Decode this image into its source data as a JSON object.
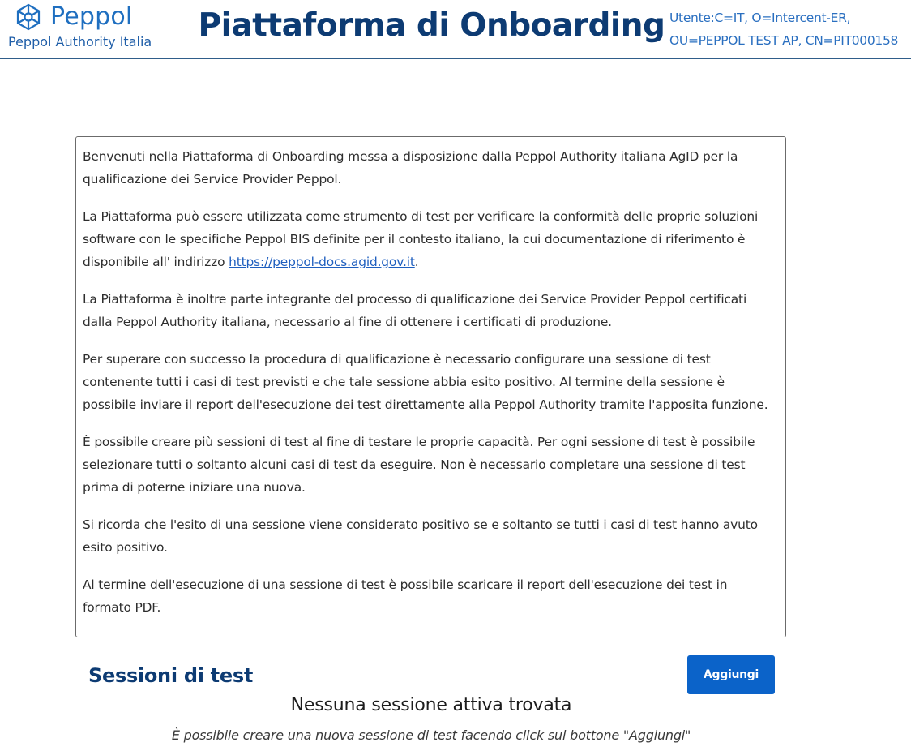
{
  "header": {
    "logo_text": "Peppol",
    "logo_subtitle": "Peppol Authority Italia",
    "title": "Piattaforma di Onboarding",
    "user_line1": "Utente:C=IT, O=Intercent-ER,",
    "user_line2": "OU=PEPPOL TEST AP, CN=PIT000158",
    "logo_icon": "peppol-network-logo",
    "brand_color": "#1f6fc0"
  },
  "intro": {
    "p1": "Benvenuti nella Piattaforma di Onboarding messa a disposizione dalla Peppol Authority italiana AgID per la qualificazione dei Service Provider Peppol.",
    "p2_before": "La Piattaforma può essere utilizzata come strumento di test per verificare la conformità delle proprie soluzioni software con le specifiche Peppol BIS definite per il contesto italiano, la cui documentazione di riferimento è disponibile all' indirizzo ",
    "p2_link": "https://peppol-docs.agid.gov.it",
    "p2_after": ".",
    "p3": "La Piattaforma è inoltre parte integrante del processo di qualificazione dei Service Provider Peppol certificati dalla Peppol Authority italiana, necessario al fine di ottenere i certificati di produzione.",
    "p4": "Per superare con successo la procedura di qualificazione è necessario configurare una sessione di test contenente tutti i casi di test previsti e che tale sessione abbia esito positivo. Al termine della sessione è possibile inviare il report dell'esecuzione dei test direttamente alla Peppol Authority tramite l'apposita funzione.",
    "p5": "È possibile creare più sessioni di test al fine di testare le proprie capacità. Per ogni sessione di test è possibile selezionare tutti o soltanto alcuni casi di test da eseguire. Non è necessario completare una sessione di test prima di poterne iniziare una nuova.",
    "p6": "Si ricorda che l'esito di una sessione viene considerato positivo se e soltanto se tutti i casi di test hanno avuto esito positivo.",
    "p7": "Al termine dell'esecuzione di una sessione di test è possibile scaricare il report dell'esecuzione dei test in formato PDF."
  },
  "sessions": {
    "title": "Sessioni di test",
    "add_label": "Aggiungi",
    "empty_title": "Nessuna sessione attiva trovata",
    "empty_hint": "È possibile creare una nuova sessione di test facendo click sul bottone \"Aggiungi\"",
    "button_color": "#0b63c9"
  }
}
